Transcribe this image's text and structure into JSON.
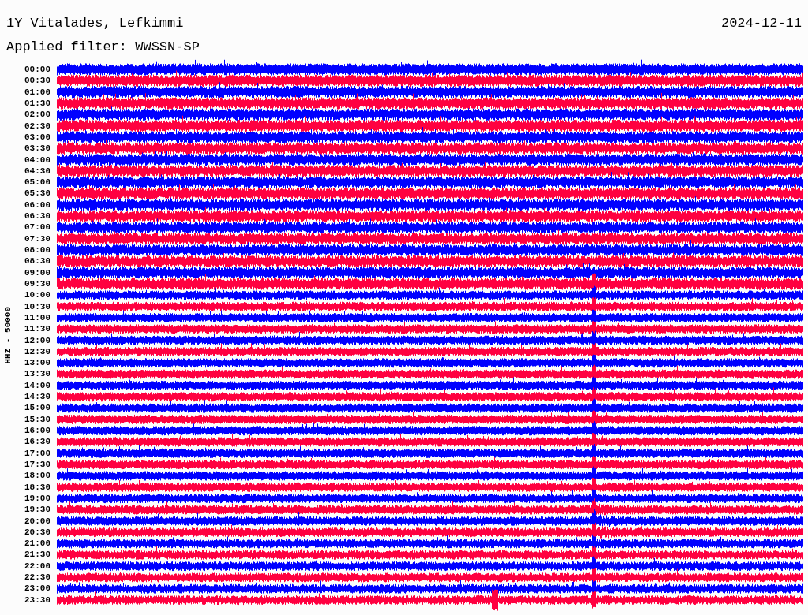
{
  "header": {
    "station": "1Y Vitalades, Lefkimmi",
    "date": "2024-12-11",
    "filter": "Applied filter: WWSSN-SP"
  },
  "axis_label": "HHZ - 50000",
  "traces": [
    {
      "time": "00:00",
      "color": "#0000ff"
    },
    {
      "time": "00:30",
      "color": "#ff0040"
    },
    {
      "time": "01:00",
      "color": "#0000ff"
    },
    {
      "time": "01:30",
      "color": "#ff0040"
    },
    {
      "time": "02:00",
      "color": "#0000ff"
    },
    {
      "time": "02:30",
      "color": "#ff0040"
    },
    {
      "time": "03:00",
      "color": "#0000ff"
    },
    {
      "time": "03:30",
      "color": "#ff0040"
    },
    {
      "time": "04:00",
      "color": "#0000ff"
    },
    {
      "time": "04:30",
      "color": "#ff0040"
    },
    {
      "time": "05:00",
      "color": "#0000ff"
    },
    {
      "time": "05:30",
      "color": "#ff0040"
    },
    {
      "time": "06:00",
      "color": "#0000ff"
    },
    {
      "time": "06:30",
      "color": "#ff0040"
    },
    {
      "time": "07:00",
      "color": "#0000ff"
    },
    {
      "time": "07:30",
      "color": "#ff0040"
    },
    {
      "time": "08:00",
      "color": "#0000ff"
    },
    {
      "time": "08:30",
      "color": "#ff0040"
    },
    {
      "time": "09:00",
      "color": "#0000ff"
    },
    {
      "time": "09:30",
      "color": "#ff0040"
    },
    {
      "time": "10:00",
      "color": "#0000ff"
    },
    {
      "time": "10:30",
      "color": "#ff0040"
    },
    {
      "time": "11:00",
      "color": "#0000ff"
    },
    {
      "time": "11:30",
      "color": "#ff0040"
    },
    {
      "time": "12:00",
      "color": "#0000ff"
    },
    {
      "time": "12:30",
      "color": "#ff0040"
    },
    {
      "time": "13:00",
      "color": "#0000ff"
    },
    {
      "time": "13:30",
      "color": "#ff0040"
    },
    {
      "time": "14:00",
      "color": "#0000ff"
    },
    {
      "time": "14:30",
      "color": "#ff0040"
    },
    {
      "time": "15:00",
      "color": "#0000ff"
    },
    {
      "time": "15:30",
      "color": "#ff0040"
    },
    {
      "time": "16:00",
      "color": "#0000ff"
    },
    {
      "time": "16:30",
      "color": "#ff0040"
    },
    {
      "time": "17:00",
      "color": "#0000ff"
    },
    {
      "time": "17:30",
      "color": "#ff0040"
    },
    {
      "time": "18:00",
      "color": "#0000ff"
    },
    {
      "time": "18:30",
      "color": "#ff0040"
    },
    {
      "time": "19:00",
      "color": "#0000ff"
    },
    {
      "time": "19:30",
      "color": "#ff0040"
    },
    {
      "time": "20:00",
      "color": "#0000ff"
    },
    {
      "time": "20:30",
      "color": "#ff0040"
    },
    {
      "time": "21:00",
      "color": "#0000ff"
    },
    {
      "time": "21:30",
      "color": "#ff0040"
    },
    {
      "time": "22:00",
      "color": "#0000ff"
    },
    {
      "time": "22:30",
      "color": "#ff0040"
    },
    {
      "time": "23:00",
      "color": "#0000ff"
    },
    {
      "time": "23:30",
      "color": "#ff0040"
    }
  ]
}
